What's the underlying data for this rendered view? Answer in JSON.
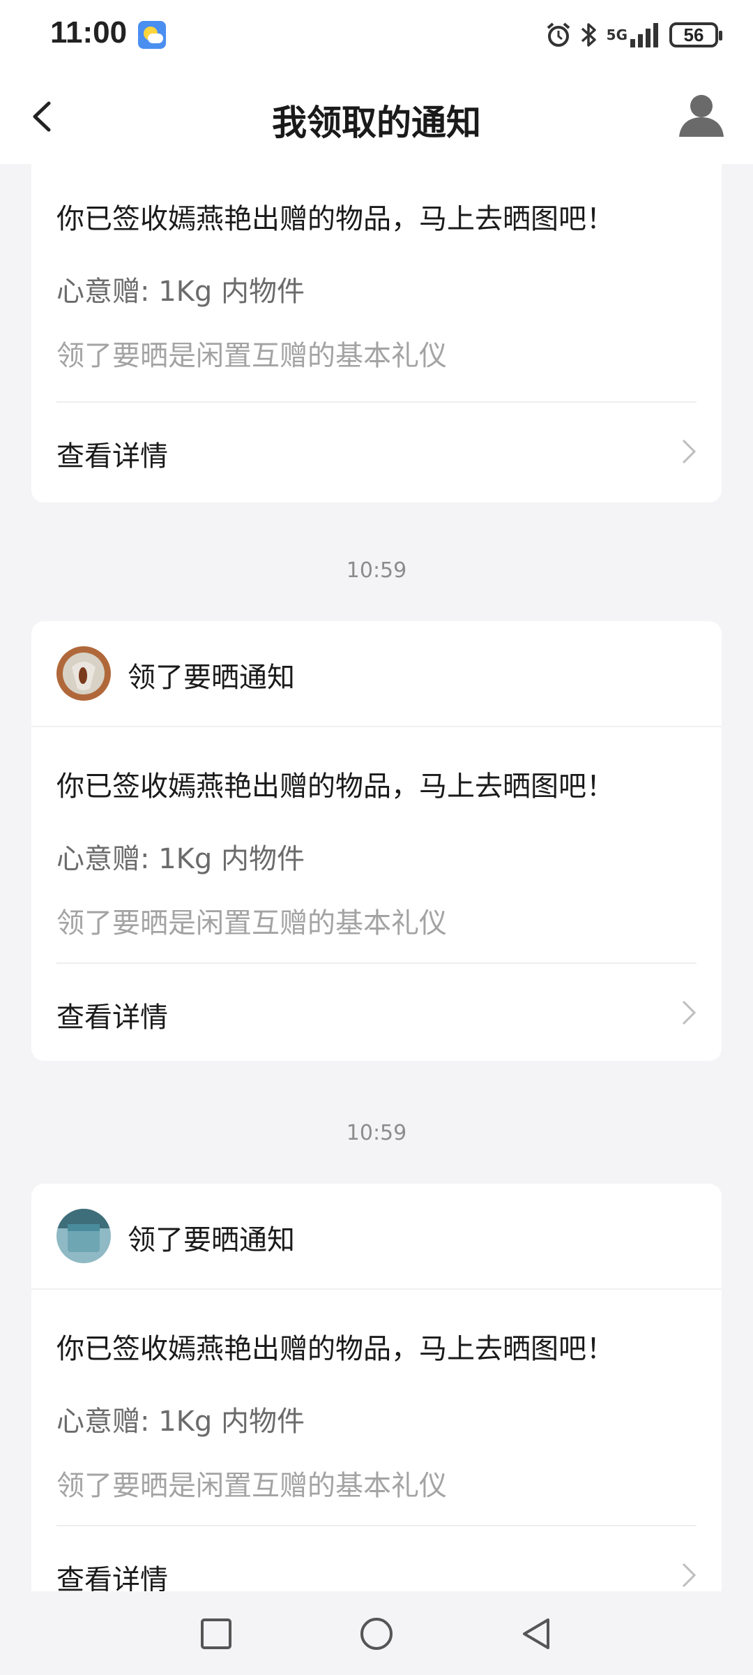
{
  "status_bar": {
    "time": "11:00",
    "network": "5G",
    "battery": "56",
    "icons": [
      "weather-icon",
      "alarm-icon",
      "bluetooth-icon",
      "signal-icon",
      "battery-icon"
    ]
  },
  "header": {
    "title": "我领取的通知",
    "back_icon": "back-arrow-icon",
    "profile_icon": "user-icon"
  },
  "timestamps": [
    "10:59",
    "10:59"
  ],
  "cards": [
    {
      "header_title": "",
      "message": "你已签收嫣燕艳出赠的物品，马上去晒图吧！",
      "gift_line": "心意赠: 1Kg 内物件",
      "note": "领了要晒是闲置互赠的基本礼仪",
      "detail_label": "查看详情"
    },
    {
      "header_title": "领了要晒通知",
      "message": "你已签收嫣燕艳出赠的物品，马上去晒图吧！",
      "gift_line": "心意赠: 1Kg 内物件",
      "note": "领了要晒是闲置互赠的基本礼仪",
      "detail_label": "查看详情"
    },
    {
      "header_title": "领了要晒通知",
      "message": "你已签收嫣燕艳出赠的物品，马上去晒图吧！",
      "gift_line": "心意赠: 1Kg 内物件",
      "note": "领了要晒是闲置互赠的基本礼仪",
      "detail_label": "查看详情"
    }
  ],
  "nav_bar": {
    "icons": [
      "recent-apps-icon",
      "home-icon",
      "back-icon"
    ]
  }
}
